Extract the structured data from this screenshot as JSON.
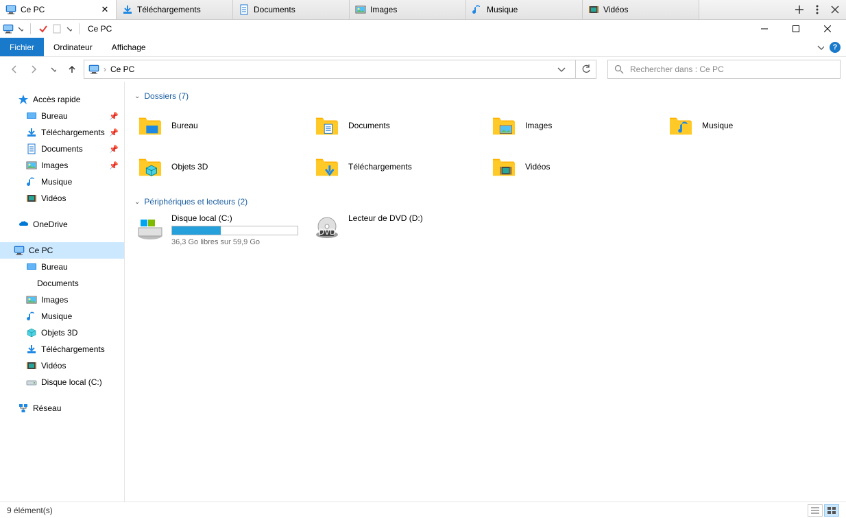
{
  "tabs": [
    {
      "label": "Ce PC",
      "icon": "monitor",
      "active": true
    },
    {
      "label": "Téléchargements",
      "icon": "download"
    },
    {
      "label": "Documents",
      "icon": "document"
    },
    {
      "label": "Images",
      "icon": "images"
    },
    {
      "label": "Musique",
      "icon": "music"
    },
    {
      "label": "Vidéos",
      "icon": "video"
    }
  ],
  "title": "Ce PC",
  "ribbon": {
    "file": "Fichier",
    "computer": "Ordinateur",
    "view": "Affichage"
  },
  "address": {
    "location": "Ce PC"
  },
  "search": {
    "placeholder": "Rechercher dans : Ce PC"
  },
  "sidebar": {
    "quick": {
      "label": "Accès rapide",
      "items": [
        {
          "label": "Bureau",
          "icon": "desktop",
          "pinned": true
        },
        {
          "label": "Téléchargements",
          "icon": "download",
          "pinned": true
        },
        {
          "label": "Documents",
          "icon": "document",
          "pinned": true
        },
        {
          "label": "Images",
          "icon": "images",
          "pinned": true
        },
        {
          "label": "Musique",
          "icon": "music"
        },
        {
          "label": "Vidéos",
          "icon": "video"
        }
      ]
    },
    "onedrive": {
      "label": "OneDrive"
    },
    "thispc": {
      "label": "Ce PC",
      "items": [
        {
          "label": "Bureau",
          "icon": "desktop"
        },
        {
          "label": "Documents",
          "icon": "document-plain"
        },
        {
          "label": "Images",
          "icon": "images"
        },
        {
          "label": "Musique",
          "icon": "music"
        },
        {
          "label": "Objets 3D",
          "icon": "objects3d"
        },
        {
          "label": "Téléchargements",
          "icon": "download"
        },
        {
          "label": "Vidéos",
          "icon": "video"
        },
        {
          "label": "Disque local (C:)",
          "icon": "drive"
        }
      ]
    },
    "network": {
      "label": "Réseau"
    }
  },
  "sections": {
    "folders": {
      "title": "Dossiers (7)",
      "items": [
        {
          "label": "Bureau",
          "icon": "desktop-big"
        },
        {
          "label": "Documents",
          "icon": "document-big"
        },
        {
          "label": "Images",
          "icon": "images-big"
        },
        {
          "label": "Musique",
          "icon": "music-big"
        },
        {
          "label": "Objets 3D",
          "icon": "objects3d-big"
        },
        {
          "label": "Téléchargements",
          "icon": "download-big"
        },
        {
          "label": "Vidéos",
          "icon": "video-big"
        }
      ]
    },
    "devices": {
      "title": "Périphériques et lecteurs (2)",
      "items": [
        {
          "label": "Disque local (C:)",
          "sub": "36,3 Go libres sur 59,9 Go",
          "fill": 39,
          "icon": "drive-c"
        },
        {
          "label": "Lecteur de DVD (D:)",
          "icon": "dvd"
        }
      ]
    }
  },
  "status": {
    "count": "9 élément(s)"
  }
}
